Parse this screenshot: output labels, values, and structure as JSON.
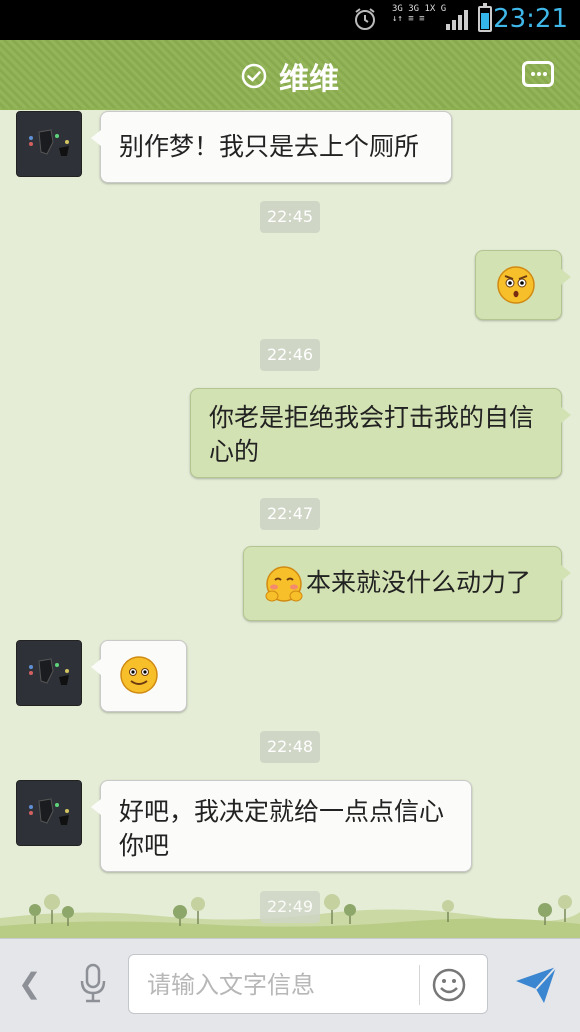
{
  "status_bar": {
    "time": "23:21",
    "network_labels": [
      "3G 3G 1X G",
      "↓↑ ≡ ≡"
    ]
  },
  "header": {
    "title": "维维"
  },
  "messages": [
    {
      "type": "in",
      "text": "别作梦！我只是去上个厕所"
    },
    {
      "type": "time",
      "text": "22:45"
    },
    {
      "type": "out",
      "emoji": "shocked-emoji"
    },
    {
      "type": "time",
      "text": "22:46"
    },
    {
      "type": "out",
      "text": "你老是拒绝我会打击我的自信心的"
    },
    {
      "type": "time",
      "text": "22:47"
    },
    {
      "type": "out",
      "emoji": "shy-emoji",
      "text": "本来就没什么动力了"
    },
    {
      "type": "in",
      "emoji": "smile-emoji"
    },
    {
      "type": "time",
      "text": "22:48"
    },
    {
      "type": "in",
      "text": "好吧，我决定就给一点点信心你吧"
    },
    {
      "type": "time",
      "text": "22:49"
    }
  ],
  "input_bar": {
    "placeholder": "请输入文字信息",
    "value": ""
  },
  "colors": {
    "header": "#8db050",
    "outgoing_bubble": "#d3e2b3",
    "incoming_bubble": "#fbfcfa",
    "clock": "#3fb7e8",
    "send": "#3a86d1"
  }
}
